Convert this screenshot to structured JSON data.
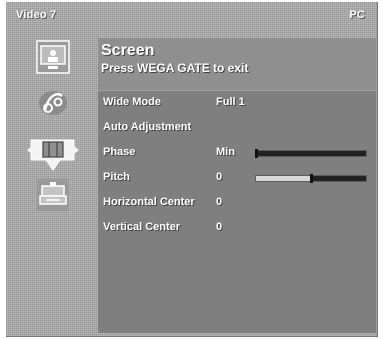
{
  "header": {
    "input": "Video 7",
    "mode": "PC"
  },
  "title": {
    "line1": "Screen",
    "line2": "Press WEGA GATE to exit"
  },
  "rail_icons": [
    "picture-icon",
    "sound-icon",
    "screen-icon",
    "setup-icon"
  ],
  "selected_rail_icon": "screen-icon",
  "menu": [
    {
      "label": "Wide Mode",
      "value": "Full 1"
    },
    {
      "label": "Auto Adjustment",
      "value": ""
    },
    {
      "label": "Phase",
      "value": "Min",
      "slider": 0.0
    },
    {
      "label": "Pitch",
      "value": "0",
      "slider": 0.5
    },
    {
      "label": "Horizontal Center",
      "value": "0"
    },
    {
      "label": "Vertical Center",
      "value": "0"
    }
  ]
}
